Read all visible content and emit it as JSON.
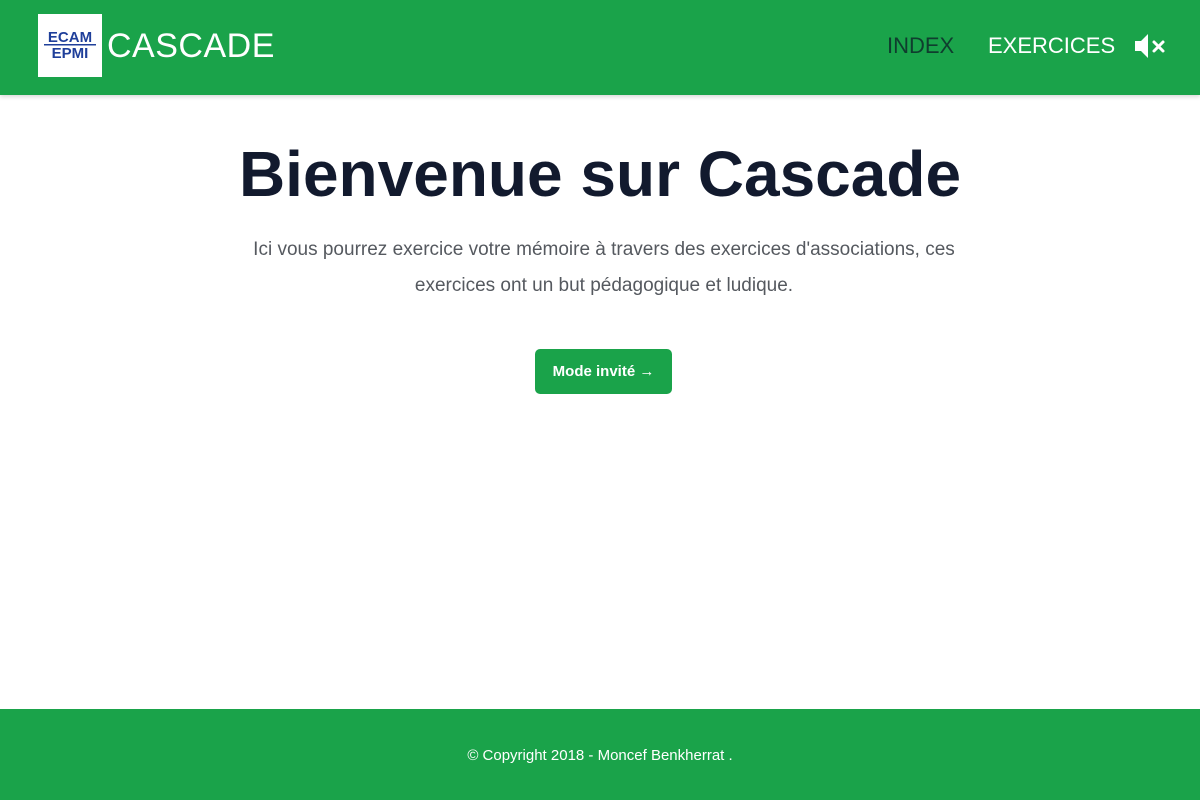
{
  "header": {
    "logo_text_top": "ECAM",
    "logo_text_bottom": "EPMI",
    "brand": "CASCADE",
    "nav": [
      {
        "label": "INDEX",
        "active": true
      },
      {
        "label": "EXERCICES",
        "active": false
      }
    ],
    "mute_icon": "speaker-mute-icon"
  },
  "main": {
    "title": "Bienvenue sur Cascade",
    "description": "Ici vous pourrez exercice votre mémoire à travers des exercices d'associations, ces exercices ont un but pédagogique et ludique.",
    "cta_label": "Mode invité →"
  },
  "footer": {
    "copyright": "© Copyright 2018 - Moncef Benkherrat ."
  },
  "colors": {
    "brand_green": "#1aa34a",
    "title_dark": "#121a2e",
    "active_nav": "#0f3d2e"
  }
}
